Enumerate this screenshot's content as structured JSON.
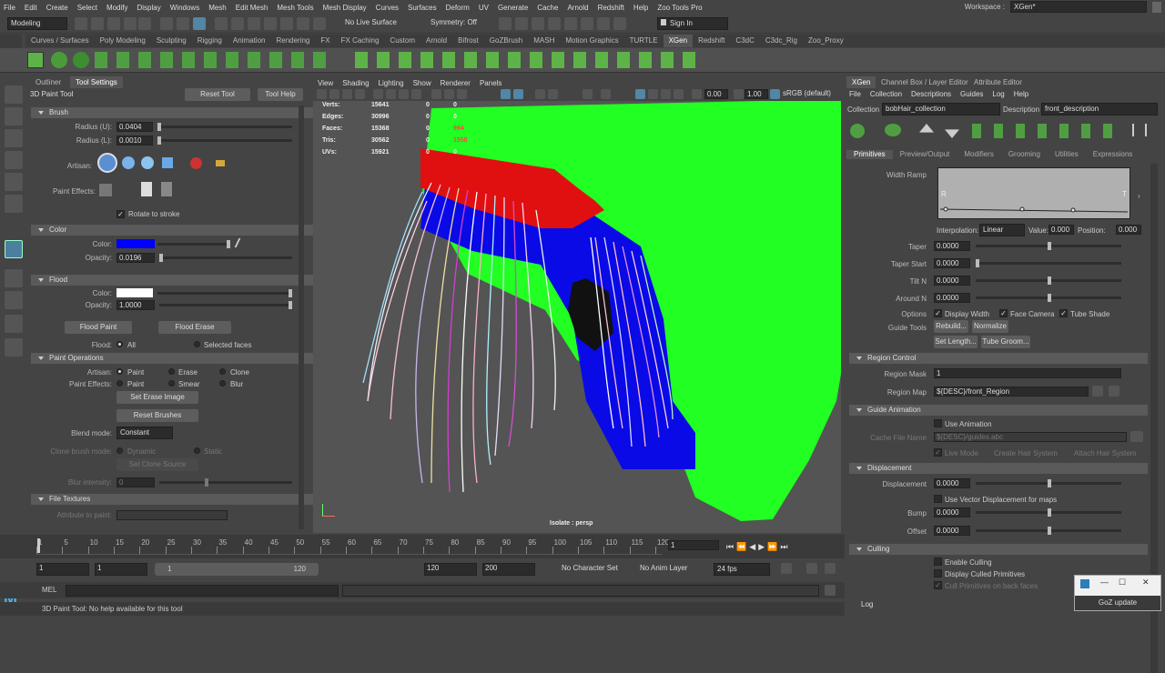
{
  "menubar": {
    "items": [
      "File",
      "Edit",
      "Create",
      "Select",
      "Modify",
      "Display",
      "Windows",
      "Mesh",
      "Edit Mesh",
      "Mesh Tools",
      "Mesh Display",
      "Curves",
      "Surfaces",
      "Deform",
      "UV",
      "Generate",
      "Cache",
      "Arnold",
      "Redshift",
      "Help",
      "Zoo Tools Pro"
    ],
    "workspace_label": "Workspace :",
    "workspace_value": "XGen*"
  },
  "statusline": {
    "mode": "Modeling",
    "live_surface": "No Live Surface",
    "symmetry": "Symmetry: Off",
    "sign_in": "Sign In"
  },
  "shelf_tabs": [
    "Curves / Surfaces",
    "Poly Modeling",
    "Sculpting",
    "Rigging",
    "Animation",
    "Rendering",
    "FX",
    "FX Caching",
    "Custom",
    "Arnold",
    "Bifrost",
    "GoZBrush",
    "MASH",
    "Motion Graphics",
    "TURTLE",
    "XGen",
    "Redshift",
    "C3dC",
    "C3dc_Rig",
    "Zoo_Proxy"
  ],
  "shelf_active": "XGen",
  "left_panel": {
    "tabs": [
      "Outliner",
      "Tool Settings"
    ],
    "tool_name": "3D Paint Tool",
    "reset_tool": "Reset Tool",
    "tool_help": "Tool Help",
    "brush": {
      "title": "Brush",
      "radius_u_label": "Radius (U):",
      "radius_u": "0.0404",
      "radius_l_label": "Radius (L):",
      "radius_l": "0.0010",
      "artisan_label": "Artisan:",
      "paint_effects_label": "Paint Effects:",
      "rotate_label": "Rotate to stroke"
    },
    "color": {
      "title": "Color",
      "color_label": "Color:",
      "color_value": "#0000ff",
      "opacity_label": "Opacity:",
      "opacity": "0.0196"
    },
    "flood": {
      "title": "Flood",
      "color_label": "Color:",
      "color_value": "#ffffff",
      "opacity_label": "Opacity:",
      "opacity": "1.0000",
      "flood_paint": "Flood Paint",
      "flood_erase": "Flood Erase",
      "flood_label": "Flood:",
      "all": "All",
      "selected_faces": "Selected faces"
    },
    "paint_ops": {
      "title": "Paint Operations",
      "artisan_label": "Artisan:",
      "paint": "Paint",
      "erase": "Erase",
      "clone": "Clone",
      "pe_label": "Paint Effects:",
      "pe_paint": "Paint",
      "smear": "Smear",
      "blur": "Blur",
      "set_erase_image": "Set Erase Image",
      "reset_brushes": "Reset Brushes",
      "blend_mode_label": "Blend mode:",
      "blend_mode": "Constant",
      "clone_brush_label": "Clone brush mode:",
      "dynamic": "Dynamic",
      "static": "Static",
      "set_clone_source": "Set Clone Source",
      "blur_intensity_label": "Blur intensity:",
      "blur_intensity": "0"
    },
    "file_textures": {
      "title": "File Textures",
      "attribute_label": "Attribute to paint:"
    }
  },
  "viewport": {
    "menu": [
      "View",
      "Shading",
      "Lighting",
      "Show",
      "Renderer",
      "Panels"
    ],
    "field1": "0.00",
    "field2": "1.00",
    "color_space": "sRGB (default)",
    "hud": [
      {
        "label": "Verts:",
        "a": "15641",
        "b": "0",
        "c": "0"
      },
      {
        "label": "Edges:",
        "a": "30996",
        "b": "0",
        "c": "0"
      },
      {
        "label": "Faces:",
        "a": "15368",
        "b": "0",
        "c": "994"
      },
      {
        "label": "Tris:",
        "a": "30562",
        "b": "0",
        "c": "1558"
      },
      {
        "label": "UVs:",
        "a": "15921",
        "b": "0",
        "c": "0"
      }
    ],
    "camera_label": "Isolate : persp"
  },
  "right_panel": {
    "tabs": [
      "XGen",
      "Channel Box / Layer Editor",
      "Attribute Editor"
    ],
    "menu": [
      "File",
      "Collection",
      "Descriptions",
      "Guides",
      "Log",
      "Help"
    ],
    "collection_label": "Collection",
    "collection": "bobHair_collection",
    "description_label": "Description",
    "description": "front_description",
    "subtabs": [
      "Primitives",
      "Preview/Output",
      "Modifiers",
      "Grooming",
      "Utilities",
      "Expressions"
    ],
    "width_ramp_label": "Width Ramp",
    "ramp_r": "R",
    "ramp_t": "T",
    "interp_label": "Interpolation:",
    "interp": "Linear",
    "value_label": "Value:",
    "value": "0.000",
    "position_label": "Position:",
    "position": "0.000",
    "taper_label": "Taper",
    "taper": "0.0000",
    "taper_start_label": "Taper Start",
    "taper_start": "0.0000",
    "tilt_label": "Tilt N",
    "tilt": "0.0000",
    "around_label": "Around N",
    "around": "0.0000",
    "options_label": "Options",
    "display_width": "Display Width",
    "face_camera": "Face Camera",
    "tube_shade": "Tube Shade",
    "guide_tools_label": "Guide Tools",
    "rebuild": "Rebuild...",
    "normalize": "Normalize",
    "set_length": "Set Length...",
    "tube_groom": "Tube Groom...",
    "region_control": "Region Control",
    "region_mask_label": "Region Mask",
    "region_mask": "1",
    "region_map_label": "Region Map",
    "region_map": "${DESC}/front_Region",
    "guide_anim": "Guide Animation",
    "use_anim": "Use Animation",
    "cache_label": "Cache File Name",
    "cache": "${DESC}/guides.abc",
    "live_mode": "Live Mode",
    "create_hair": "Create Hair System",
    "attach_hair": "Attach Hair System",
    "displacement_title": "Displacement",
    "displacement_label": "Displacement",
    "displacement": "0.0000",
    "use_vector": "Use Vector Displacement for maps",
    "bump_label": "Bump",
    "bump": "0.0000",
    "offset_label": "Offset",
    "offset": "0.0000",
    "culling_title": "Culling",
    "enable_culling": "Enable Culling",
    "display_culled": "Display Culled Primitives",
    "cull_back": "Cull Primitives on back faces",
    "log_title": "Log"
  },
  "timeline": {
    "ticks": [
      "1",
      "5",
      "10",
      "15",
      "20",
      "25",
      "30",
      "35",
      "40",
      "45",
      "50",
      "55",
      "60",
      "65",
      "70",
      "75",
      "80",
      "85",
      "90",
      "95",
      "100",
      "105",
      "110",
      "115",
      "120"
    ],
    "current": "1"
  },
  "range": {
    "start": "1",
    "inner_start": "1",
    "slider_start": "1",
    "slider_end": "120",
    "inner_end": "120",
    "end": "200",
    "character_set": "No Character Set",
    "anim_layer": "No Anim Layer",
    "fps": "24 fps"
  },
  "cmdline": {
    "label": "MEL"
  },
  "helpline": {
    "text": "3D Paint Tool: No help available for this tool"
  },
  "goz": {
    "label": "GoZ update"
  }
}
